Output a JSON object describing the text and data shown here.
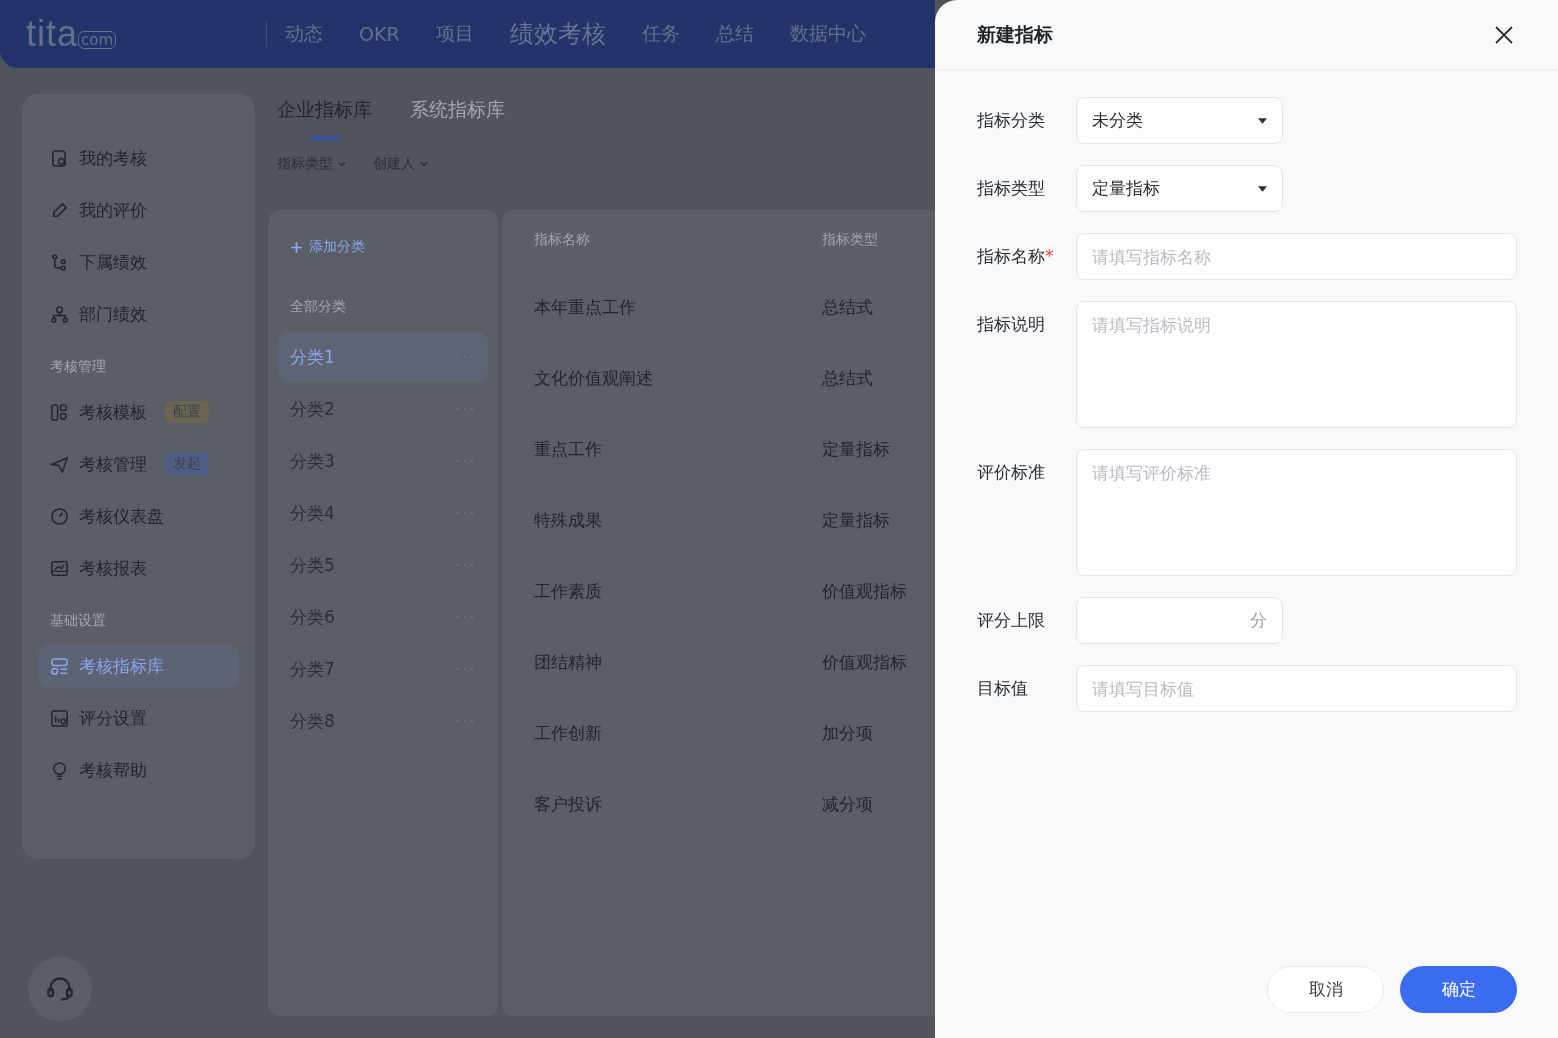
{
  "topbar": {
    "logo": "tita",
    "logo_suffix": "com",
    "nav": [
      {
        "label": "动态",
        "selected": false
      },
      {
        "label": "OKR",
        "selected": false
      },
      {
        "label": "项目",
        "selected": false
      },
      {
        "label": "绩效考核",
        "selected": true
      },
      {
        "label": "任务",
        "selected": false
      },
      {
        "label": "总结",
        "selected": false
      },
      {
        "label": "数据中心",
        "selected": false
      }
    ]
  },
  "sidebar": {
    "groups": [
      {
        "items": [
          {
            "label": "我的考核",
            "selected": false
          },
          {
            "label": "我的评价",
            "selected": false
          },
          {
            "label": "下属绩效",
            "selected": false
          },
          {
            "label": "部门绩效",
            "selected": false
          }
        ]
      },
      {
        "heading": "考核管理",
        "items": [
          {
            "label": "考核模板",
            "selected": false,
            "badge": {
              "text": "配置",
              "color": "#6b6450"
            }
          },
          {
            "label": "考核管理",
            "selected": false,
            "badge": {
              "text": "发起",
              "color": "#4f5e86"
            }
          },
          {
            "label": "考核仪表盘",
            "selected": false
          },
          {
            "label": "考核报表",
            "selected": false
          }
        ]
      },
      {
        "heading": "基础设置",
        "items": [
          {
            "label": "考核指标库",
            "selected": true
          },
          {
            "label": "评分设置",
            "selected": false
          },
          {
            "label": "考核帮助",
            "selected": false
          }
        ]
      }
    ]
  },
  "tabs": [
    {
      "label": "企业指标库",
      "selected": true
    },
    {
      "label": "系统指标库",
      "selected": false
    }
  ],
  "filters": [
    "指标类型",
    "创建人"
  ],
  "categories": {
    "add_label": "添加分类",
    "heading": "全部分类",
    "items": [
      {
        "label": "分类1",
        "selected": true
      },
      {
        "label": "分类2",
        "selected": false
      },
      {
        "label": "分类3",
        "selected": false
      },
      {
        "label": "分类4",
        "selected": false
      },
      {
        "label": "分类5",
        "selected": false
      },
      {
        "label": "分类6",
        "selected": false
      },
      {
        "label": "分类7",
        "selected": false
      },
      {
        "label": "分类8",
        "selected": false
      }
    ]
  },
  "table": {
    "columns": [
      "指标名称",
      "指标类型"
    ],
    "rows": [
      [
        "本年重点工作",
        "总结式"
      ],
      [
        "文化价值观阐述",
        "总结式"
      ],
      [
        "重点工作",
        "定量指标"
      ],
      [
        "特殊成果",
        "定量指标"
      ],
      [
        "工作素质",
        "价值观指标"
      ],
      [
        "团结精神",
        "价值观指标"
      ],
      [
        "工作创新",
        "加分项"
      ],
      [
        "客户投诉",
        "减分项"
      ]
    ]
  },
  "drawer": {
    "title": "新建指标",
    "fields": [
      {
        "kind": "select",
        "label": "指标分类",
        "value": "未分类"
      },
      {
        "kind": "select",
        "label": "指标类型",
        "value": "定量指标"
      },
      {
        "kind": "input",
        "label": "指标名称",
        "required_mark": "*",
        "placeholder": "请填写指标名称"
      },
      {
        "kind": "textarea",
        "label": "指标说明",
        "placeholder": "请填写指标说明"
      },
      {
        "kind": "textarea",
        "label": "评价标准",
        "placeholder": "请填写评价标准"
      },
      {
        "kind": "number",
        "label": "评分上限",
        "unit": "分"
      },
      {
        "kind": "input",
        "label": "目标值",
        "placeholder": "请填写目标值"
      }
    ],
    "buttons": [
      {
        "kind": "secondary",
        "label": "取消"
      },
      {
        "kind": "primary",
        "label": "确定"
      }
    ]
  }
}
